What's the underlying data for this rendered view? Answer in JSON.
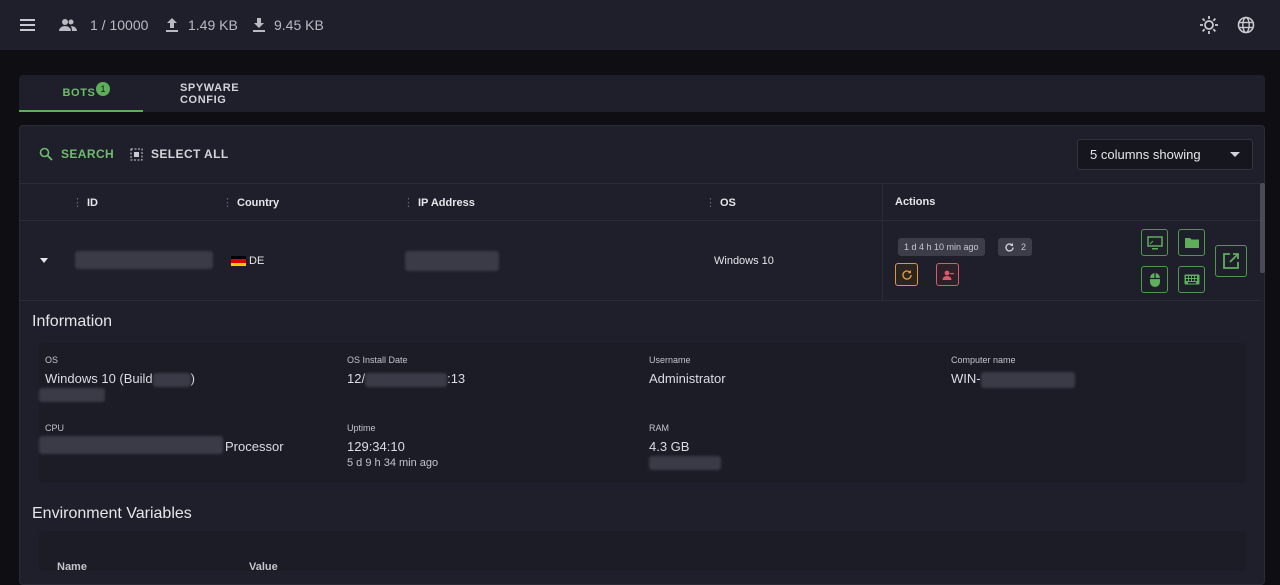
{
  "topbar": {
    "clients": "1 / 10000",
    "upload": "1.49 KB",
    "download": "9.45 KB"
  },
  "tabs": [
    {
      "label": "BOTS",
      "badge": "1"
    },
    {
      "label": "SPYWARE CONFIG"
    }
  ],
  "toolbar": {
    "search_label": "SEARCH",
    "select_all_label": "SELECT ALL",
    "columns_label": "5 columns showing"
  },
  "table": {
    "headers": {
      "id": "ID",
      "country": "Country",
      "ip": "IP Address",
      "os": "OS",
      "actions": "Actions"
    },
    "row": {
      "country": "DE",
      "os": "Windows 10",
      "last_seen": "1 d 4 h 10 min ago",
      "reconnects": "2"
    }
  },
  "information": {
    "title": "Information",
    "os_label": "OS",
    "os_value_prefix": "Windows 10 (Build",
    "os_value_suffix": ")",
    "install_label": "OS Install Date",
    "install_prefix": "12/",
    "install_suffix": ":13",
    "username_label": "Username",
    "username_value": "Administrator",
    "computer_label": "Computer name",
    "computer_prefix": "WIN-",
    "cpu_label": "CPU",
    "cpu_suffix": "Processor",
    "uptime_label": "Uptime",
    "uptime_value": "129:34:10",
    "uptime_sub": "5 d 9 h 34 min ago",
    "ram_label": "RAM",
    "ram_value": "4.3 GB"
  },
  "environment": {
    "title": "Environment Variables",
    "col_name": "Name",
    "col_value": "Value"
  },
  "colors": {
    "accent": "#5fae5c",
    "orange": "#e0973a",
    "red": "#e0566c",
    "background": "#1e1f2b"
  }
}
